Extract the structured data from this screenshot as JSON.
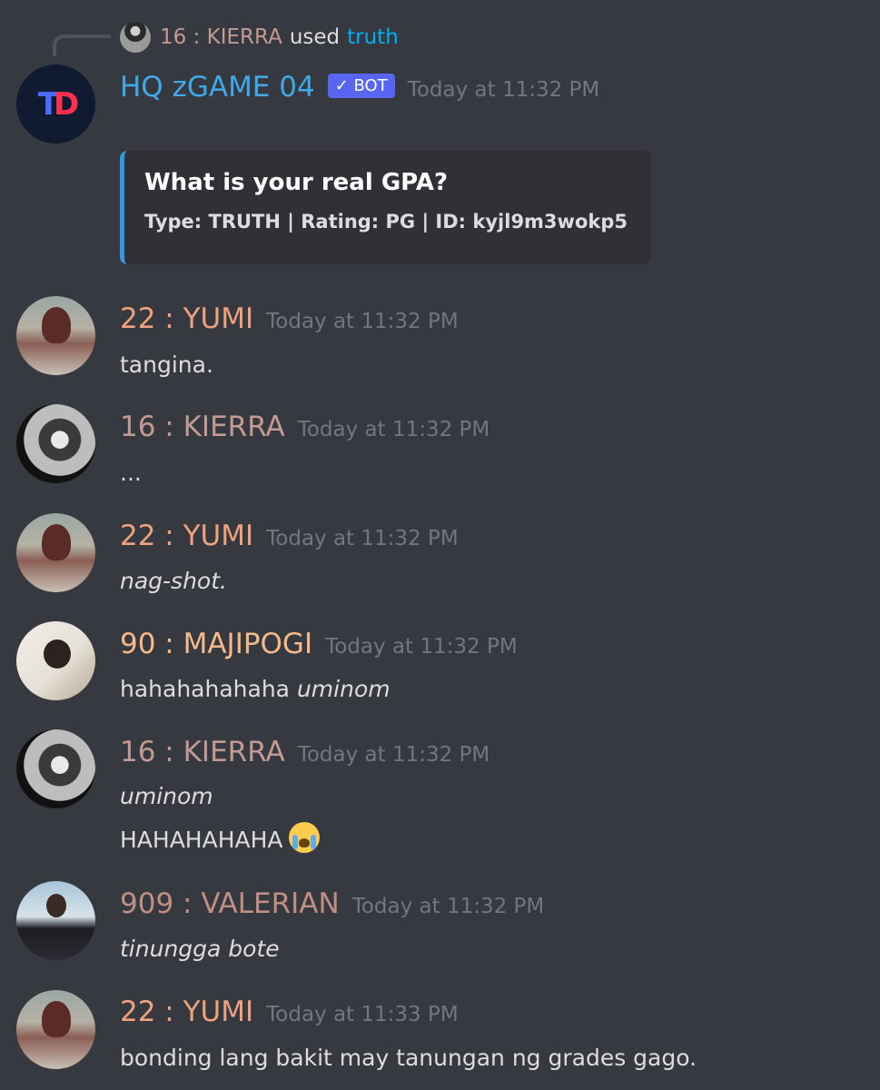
{
  "reply": {
    "name": "16 : KIERRA",
    "used": "used",
    "command": "truth"
  },
  "bot": {
    "logo_t": "T",
    "logo_d": "D",
    "name": "HQ zGAME 04",
    "badge": "✓ BOT",
    "timestamp": "Today at 11:32 PM",
    "embed": {
      "title": "What is your real GPA?",
      "description": "Type: TRUTH | Rating: PG | ID: kyjl9m3wokp5",
      "accent_color": "#3498db"
    }
  },
  "messages": [
    {
      "author": "22 : YUMI",
      "color": "#f0a17e",
      "timestamp": "Today at 11:32 PM",
      "text": "tangina."
    },
    {
      "author": "16 : KIERRA",
      "color": "#c29a93",
      "timestamp": "Today at 11:32 PM",
      "text": "..."
    },
    {
      "author": "22 : YUMI",
      "color": "#f0a17e",
      "timestamp": "Today at 11:32 PM",
      "text": "nag-shot."
    },
    {
      "author": "90 : MAJIPOGI",
      "color": "#f5b98a",
      "timestamp": "Today at 11:32 PM",
      "text_plain": "hahahahahaha",
      "text_italic": "uminom"
    },
    {
      "author": "16 : KIERRA",
      "color": "#c29a93",
      "timestamp": "Today at 11:32 PM",
      "line1": "uminom",
      "line2": "HAHAHAHAHA",
      "emoji": "loudly-crying-face"
    },
    {
      "author": "909 : VALERIAN",
      "color": "#c08f83",
      "timestamp": "Today at 11:32 PM",
      "text": "tinungga bote"
    },
    {
      "author": "22 : YUMI",
      "color": "#f0a17e",
      "timestamp": "Today at 11:33 PM",
      "text": "bonding lang bakit may tanungan ng grades gago."
    }
  ],
  "colors": {
    "background": "#36393f",
    "timestamp": "#72767d",
    "link": "#00aff4",
    "bot_badge": "#5865f2",
    "bot_name": "#3fa9e8"
  }
}
